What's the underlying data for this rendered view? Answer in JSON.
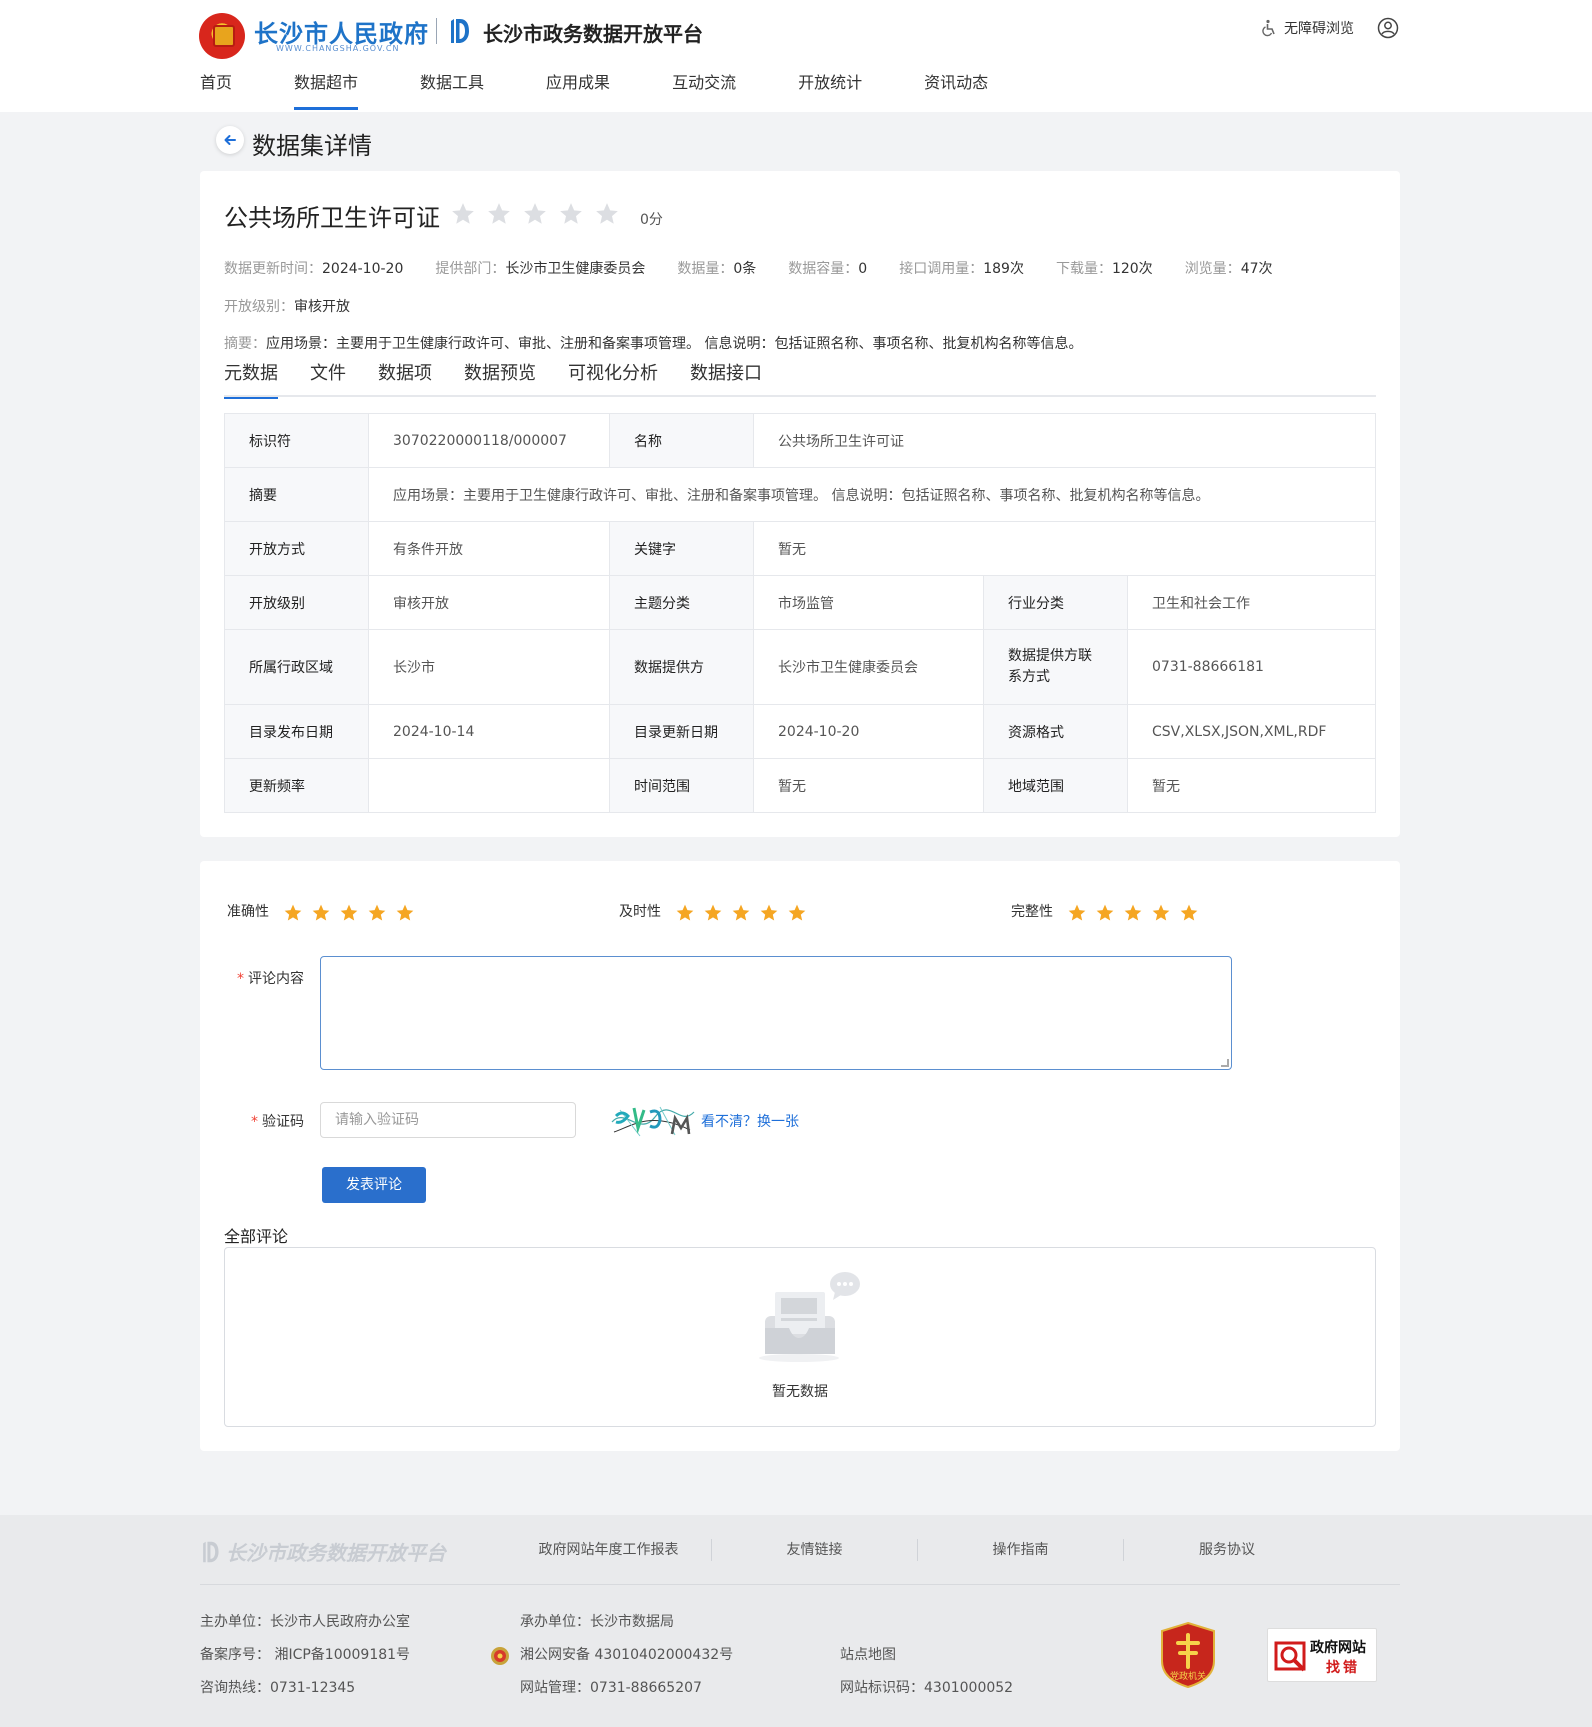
{
  "header": {
    "gov_name": "长沙市人民政府",
    "gov_url": "WWW.CHANGSHA.GOV.CN",
    "platform_name": "长沙市政务数据开放平台",
    "accessibility": "无障碍浏览",
    "brand_color": "#1e73c8"
  },
  "nav": {
    "items": [
      "首页",
      "数据超市",
      "数据工具",
      "应用成果",
      "互动交流",
      "开放统计",
      "资讯动态"
    ],
    "active": "数据超市"
  },
  "page": {
    "title": "数据集详情"
  },
  "dataset": {
    "title": "公共场所卫生许可证",
    "rating_stars": 0,
    "score": "0分",
    "meta": [
      {
        "k": "数据更新时间：",
        "v": "2024-10-20"
      },
      {
        "k": "提供部门：",
        "v": "长沙市卫生健康委员会"
      },
      {
        "k": "数据量：",
        "v": "0条"
      },
      {
        "k": "数据容量：",
        "v": "0"
      },
      {
        "k": "接口调用量：",
        "v": "189次"
      },
      {
        "k": "下载量：",
        "v": "120次"
      },
      {
        "k": "浏览量：",
        "v": "47次"
      }
    ],
    "open_level": {
      "k": "开放级别：",
      "v": "审核开放"
    },
    "summary": {
      "k": "摘要：",
      "v": "应用场景：主要用于卫生健康行政许可、审批、注册和备案事项管理。 信息说明：包括证照名称、事项名称、批复机构名称等信息。"
    }
  },
  "tabs": [
    "元数据",
    "文件",
    "数据项",
    "数据预览",
    "可视化分析",
    "数据接口"
  ],
  "active_tab": "元数据",
  "metadata": {
    "identifier_label": "标识符",
    "identifier": "3070220000118/000007",
    "name_label": "名称",
    "name": "公共场所卫生许可证",
    "summary_label": "摘要",
    "summary": "应用场景：主要用于卫生健康行政许可、审批、注册和备案事项管理。 信息说明：包括证照名称、事项名称、批复机构名称等信息。",
    "open_mode_label": "开放方式",
    "open_mode": "有条件开放",
    "keyword_label": "关键字",
    "keyword": "暂无",
    "open_level_label": "开放级别",
    "open_level": "审核开放",
    "topic_label": "主题分类",
    "topic": "市场监管",
    "industry_label": "行业分类",
    "industry": "卫生和社会工作",
    "region_label": "所属行政区域",
    "region": "长沙市",
    "provider_label": "数据提供方",
    "provider": "长沙市卫生健康委员会",
    "contact_label": "数据提供方联系方式",
    "contact": "0731-88666181",
    "publish_date_label": "目录发布日期",
    "publish_date": "2024-10-14",
    "update_date_label": "目录更新日期",
    "update_date": "2024-10-20",
    "format_label": "资源格式",
    "format": "CSV,XLSX,JSON,XML,RDF",
    "frequency_label": "更新频率",
    "frequency": "",
    "time_range_label": "时间范围",
    "time_range": "暂无",
    "geo_range_label": "地域范围",
    "geo_range": "暂无"
  },
  "rating": {
    "accuracy": {
      "label": "准确性",
      "stars": 5
    },
    "timeliness": {
      "label": "及时性",
      "stars": 5
    },
    "completeness": {
      "label": "完整性",
      "stars": 5
    },
    "star_color": "#f5a623"
  },
  "comment_form": {
    "content_label": "评论内容",
    "content_value": "",
    "captcha_label": "验证码",
    "captcha_placeholder": "请输入验证码",
    "captcha_refresh": "看不清？换一张",
    "submit": "发表评论"
  },
  "comments": {
    "title": "全部评论",
    "empty": "暂无数据"
  },
  "footer": {
    "logo": "长沙市政务数据开放平台",
    "links": [
      "政府网站年度工作报表",
      "友情链接",
      "操作指南",
      "服务协议"
    ],
    "sponsor": "主办单位：长沙市人民政府办公室",
    "organizer": "承办单位：长沙市数据局",
    "icp": "备案序号： 湘ICP备10009181号",
    "police": "湘公网安备 43010402000432号",
    "sitemap": "站点地图",
    "hotline": "咨询热线：0731-12345",
    "admin": "网站管理：0731-88665207",
    "site_id": "网站标识码：4301000052",
    "badge_party": "党政机关",
    "badge_error_1": "政府网站",
    "badge_error_2": "找错"
  }
}
